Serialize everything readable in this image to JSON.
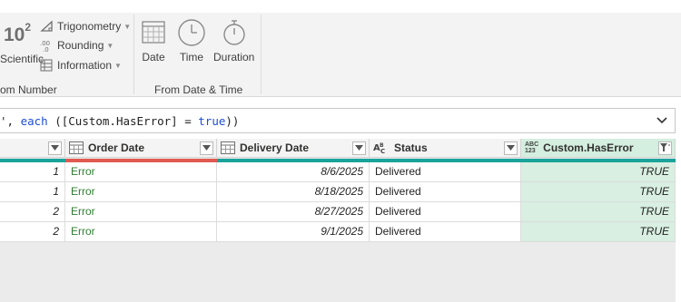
{
  "ribbon": {
    "scientific_glyph": "10",
    "scientific_exp": "2",
    "scientific_label": "Scientific",
    "trigonometry_label": "Trigonometry",
    "rounding_label": "Rounding",
    "information_label": "Information",
    "number_group_label": "om Number",
    "date_label": "Date",
    "time_label": "Time",
    "duration_label": "Duration",
    "datetime_group_label": "From Date & Time"
  },
  "formula": {
    "prefix": "', ",
    "keyword": "each",
    "middle": " ([Custom.HasError] = ",
    "value": "true",
    "suffix": "))"
  },
  "columns": [
    {
      "name": "",
      "type_icon": "number-type-icon"
    },
    {
      "name": "Order Date",
      "type_icon": "table-type-icon"
    },
    {
      "name": "Delivery Date",
      "type_icon": "table-type-icon"
    },
    {
      "name": "Status",
      "type_icon": "text-type-icon"
    },
    {
      "name": "Custom.HasError",
      "type_icon": "any-type-icon",
      "type_glyph_top": "ABC",
      "type_glyph_bottom": "123"
    }
  ],
  "rows": [
    {
      "num": "1",
      "order": "Error",
      "delivery": "8/6/2025",
      "status": "Delivered",
      "has_error": "TRUE"
    },
    {
      "num": "1",
      "order": "Error",
      "delivery": "8/18/2025",
      "status": "Delivered",
      "has_error": "TRUE"
    },
    {
      "num": "2",
      "order": "Error",
      "delivery": "8/27/2025",
      "status": "Delivered",
      "has_error": "TRUE"
    },
    {
      "num": "2",
      "order": "Error",
      "delivery": "9/1/2025",
      "status": "Delivered",
      "has_error": "TRUE"
    }
  ],
  "colors": {
    "quality_valid": "#1aa39a",
    "quality_error": "#e05a52",
    "error_text": "#2e7d32",
    "keyword": "#1d4ed8",
    "filtered_column": "#d8efe1"
  }
}
